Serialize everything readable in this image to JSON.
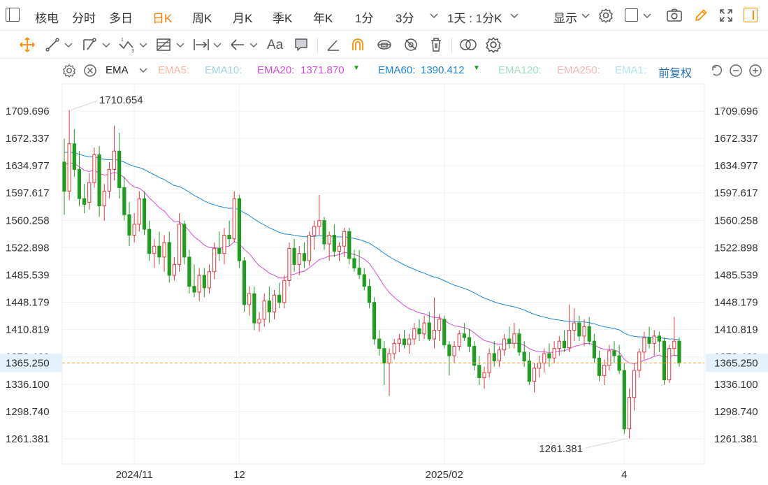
{
  "toolbar": {
    "periods": [
      "核电",
      "分时",
      "多日",
      "日K",
      "周K",
      "月K",
      "季K",
      "年K",
      "1分",
      "3分"
    ],
    "active_period": "日K",
    "interval_selector": "1天 : 1分K",
    "display_label": "显示"
  },
  "indicator": {
    "name": "EMA",
    "ema5_label": "EMA5:",
    "ema10_label": "EMA10:",
    "ema20_label": "EMA20:",
    "ema20_value": "1371.870",
    "ema60_label": "EMA60:",
    "ema60_value": "1390.412",
    "ema120_label": "EMA120:",
    "ema250_label": "EMA250:",
    "ema_more_label": "EMA1:",
    "adjust_label": "前复权",
    "colors": {
      "ema5": "#f7b89e",
      "ema10": "#9fd3ea",
      "ema20": "#d14fd6",
      "ema60": "#1f86d6",
      "ema120": "#9fe0c4",
      "ema250": "#f3b7b7",
      "ema_more": "#aee6f0"
    }
  },
  "chart_data": {
    "type": "candlestick",
    "y_ticks": [
      "1709.696",
      "1672.337",
      "1634.977",
      "1597.617",
      "1560.258",
      "1522.898",
      "1485.539",
      "1448.179",
      "1410.819",
      "1373.460",
      "1336.100",
      "1298.740",
      "1261.381"
    ],
    "ylim": [
      1223,
      1747
    ],
    "x_labels": [
      "2024/11",
      "12",
      "2025/02",
      "4"
    ],
    "x_label_index": [
      14,
      35,
      76,
      112
    ],
    "current_price": "1365.250",
    "high_label": "1710.654",
    "high_index": 1,
    "low_label": "1261.381",
    "low_index": 113,
    "colors": {
      "up": "#e0383e",
      "down": "#1e9e1e",
      "current_line": "#f2a33a",
      "current_box": "#e2f1fb"
    },
    "candles": [
      [
        1640,
        1672,
        1568,
        1600
      ],
      [
        1600,
        1711,
        1588,
        1665
      ],
      [
        1665,
        1685,
        1620,
        1630
      ],
      [
        1630,
        1655,
        1580,
        1590
      ],
      [
        1590,
        1610,
        1570,
        1582
      ],
      [
        1585,
        1625,
        1575,
        1612
      ],
      [
        1612,
        1660,
        1605,
        1650
      ],
      [
        1650,
        1662,
        1565,
        1580
      ],
      [
        1580,
        1610,
        1560,
        1600
      ],
      [
        1600,
        1640,
        1590,
        1630
      ],
      [
        1630,
        1690,
        1615,
        1655
      ],
      [
        1655,
        1680,
        1590,
        1605
      ],
      [
        1605,
        1620,
        1560,
        1568
      ],
      [
        1568,
        1585,
        1525,
        1540
      ],
      [
        1540,
        1570,
        1530,
        1555
      ],
      [
        1555,
        1600,
        1545,
        1590
      ],
      [
        1590,
        1600,
        1540,
        1548
      ],
      [
        1548,
        1560,
        1505,
        1515
      ],
      [
        1515,
        1535,
        1495,
        1525
      ],
      [
        1525,
        1545,
        1500,
        1510
      ],
      [
        1510,
        1540,
        1490,
        1530
      ],
      [
        1530,
        1545,
        1475,
        1485
      ],
      [
        1485,
        1510,
        1478,
        1500
      ],
      [
        1500,
        1570,
        1490,
        1555
      ],
      [
        1555,
        1560,
        1500,
        1510
      ],
      [
        1510,
        1520,
        1460,
        1470
      ],
      [
        1470,
        1500,
        1455,
        1462
      ],
      [
        1462,
        1495,
        1450,
        1485
      ],
      [
        1485,
        1495,
        1455,
        1468
      ],
      [
        1468,
        1500,
        1460,
        1490
      ],
      [
        1490,
        1530,
        1480,
        1522
      ],
      [
        1522,
        1545,
        1505,
        1515
      ],
      [
        1515,
        1550,
        1500,
        1540
      ],
      [
        1540,
        1560,
        1525,
        1535
      ],
      [
        1535,
        1600,
        1530,
        1590
      ],
      [
        1590,
        1595,
        1495,
        1505
      ],
      [
        1505,
        1510,
        1435,
        1445
      ],
      [
        1445,
        1470,
        1430,
        1460
      ],
      [
        1460,
        1470,
        1410,
        1420
      ],
      [
        1420,
        1435,
        1408,
        1425
      ],
      [
        1425,
        1460,
        1415,
        1450
      ],
      [
        1450,
        1470,
        1420,
        1435
      ],
      [
        1435,
        1465,
        1425,
        1458
      ],
      [
        1458,
        1475,
        1440,
        1448
      ],
      [
        1448,
        1485,
        1440,
        1478
      ],
      [
        1478,
        1530,
        1470,
        1522
      ],
      [
        1522,
        1535,
        1490,
        1500
      ],
      [
        1500,
        1525,
        1485,
        1515
      ],
      [
        1515,
        1530,
        1495,
        1505
      ],
      [
        1505,
        1545,
        1498,
        1540
      ],
      [
        1540,
        1560,
        1520,
        1552
      ],
      [
        1552,
        1595,
        1540,
        1560
      ],
      [
        1560,
        1565,
        1520,
        1528
      ],
      [
        1528,
        1545,
        1505,
        1540
      ],
      [
        1540,
        1555,
        1510,
        1518
      ],
      [
        1518,
        1530,
        1505,
        1525
      ],
      [
        1525,
        1550,
        1510,
        1545
      ],
      [
        1545,
        1550,
        1500,
        1508
      ],
      [
        1508,
        1520,
        1490,
        1495
      ],
      [
        1495,
        1520,
        1480,
        1486
      ],
      [
        1486,
        1495,
        1465,
        1470
      ],
      [
        1470,
        1480,
        1440,
        1448
      ],
      [
        1448,
        1455,
        1390,
        1398
      ],
      [
        1398,
        1410,
        1375,
        1385
      ],
      [
        1385,
        1395,
        1335,
        1365
      ],
      [
        1365,
        1385,
        1320,
        1378
      ],
      [
        1378,
        1398,
        1370,
        1392
      ],
      [
        1392,
        1405,
        1380,
        1398
      ],
      [
        1398,
        1410,
        1385,
        1390
      ],
      [
        1390,
        1405,
        1378,
        1398
      ],
      [
        1398,
        1420,
        1390,
        1412
      ],
      [
        1412,
        1425,
        1395,
        1405
      ],
      [
        1405,
        1430,
        1398,
        1420
      ],
      [
        1420,
        1435,
        1395,
        1398
      ],
      [
        1398,
        1455,
        1385,
        1410
      ],
      [
        1410,
        1432,
        1395,
        1425
      ],
      [
        1425,
        1430,
        1385,
        1390
      ],
      [
        1390,
        1395,
        1348,
        1375
      ],
      [
        1375,
        1395,
        1365,
        1388
      ],
      [
        1388,
        1410,
        1382,
        1405
      ],
      [
        1405,
        1420,
        1395,
        1400
      ],
      [
        1400,
        1412,
        1380,
        1388
      ],
      [
        1388,
        1395,
        1355,
        1362
      ],
      [
        1362,
        1375,
        1335,
        1345
      ],
      [
        1345,
        1360,
        1330,
        1352
      ],
      [
        1352,
        1385,
        1345,
        1378
      ],
      [
        1378,
        1395,
        1360,
        1368
      ],
      [
        1368,
        1388,
        1360,
        1383
      ],
      [
        1383,
        1405,
        1375,
        1398
      ],
      [
        1398,
        1415,
        1385,
        1392
      ],
      [
        1392,
        1420,
        1385,
        1405
      ],
      [
        1405,
        1412,
        1375,
        1380
      ],
      [
        1380,
        1395,
        1360,
        1368
      ],
      [
        1368,
        1380,
        1335,
        1340
      ],
      [
        1340,
        1365,
        1325,
        1358
      ],
      [
        1358,
        1375,
        1345,
        1365
      ],
      [
        1365,
        1385,
        1352,
        1378
      ],
      [
        1378,
        1392,
        1360,
        1372
      ],
      [
        1372,
        1395,
        1365,
        1385
      ],
      [
        1385,
        1402,
        1375,
        1395
      ],
      [
        1395,
        1410,
        1380,
        1386
      ],
      [
        1386,
        1445,
        1380,
        1410
      ],
      [
        1410,
        1440,
        1395,
        1420
      ],
      [
        1420,
        1430,
        1395,
        1402
      ],
      [
        1402,
        1425,
        1388,
        1415
      ],
      [
        1415,
        1428,
        1390,
        1395
      ],
      [
        1395,
        1405,
        1365,
        1372
      ],
      [
        1372,
        1382,
        1340,
        1348
      ],
      [
        1348,
        1370,
        1335,
        1362
      ],
      [
        1362,
        1390,
        1355,
        1382
      ],
      [
        1382,
        1395,
        1365,
        1375
      ],
      [
        1375,
        1390,
        1350,
        1355
      ],
      [
        1355,
        1365,
        1268,
        1275
      ],
      [
        1275,
        1330,
        1262,
        1318
      ],
      [
        1318,
        1365,
        1300,
        1355
      ],
      [
        1355,
        1385,
        1345,
        1380
      ],
      [
        1380,
        1408,
        1370,
        1400
      ],
      [
        1400,
        1415,
        1385,
        1392
      ],
      [
        1392,
        1410,
        1375,
        1402
      ],
      [
        1402,
        1408,
        1380,
        1395
      ],
      [
        1395,
        1400,
        1335,
        1342
      ],
      [
        1342,
        1390,
        1338,
        1385
      ],
      [
        1385,
        1428,
        1375,
        1395
      ],
      [
        1395,
        1400,
        1360,
        1365
      ]
    ]
  }
}
